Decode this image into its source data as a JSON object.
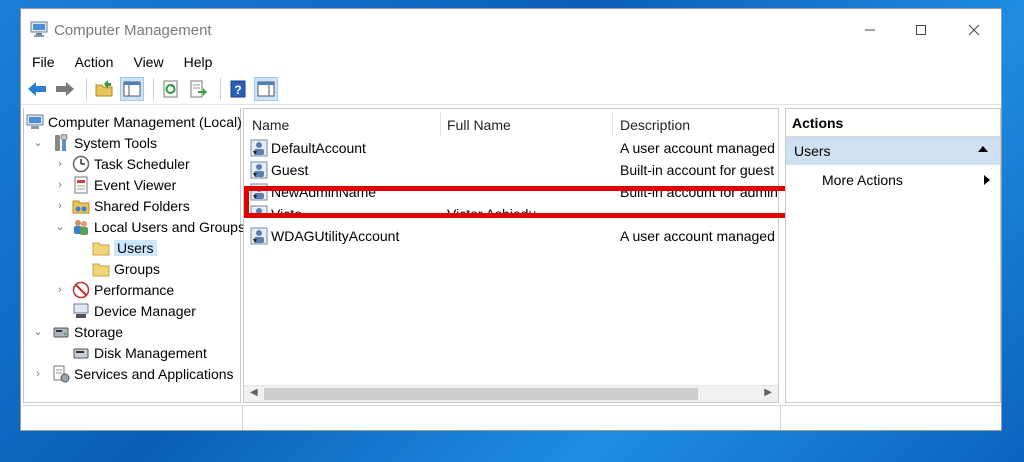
{
  "window": {
    "title": "Computer Management"
  },
  "menu": [
    "File",
    "Action",
    "View",
    "Help"
  ],
  "toolbar": {
    "buttons": [
      "back-icon",
      "forward-icon",
      "up-folder-icon",
      "show-hide-tree-icon",
      "refresh-icon",
      "export-list-icon",
      "help-icon",
      "show-hide-action-pane-icon"
    ]
  },
  "tree": {
    "root": "Computer Management (Local)",
    "system_tools": "System Tools",
    "task_scheduler": "Task Scheduler",
    "event_viewer": "Event Viewer",
    "shared_folders": "Shared Folders",
    "local_users_groups": "Local Users and Groups",
    "users": "Users",
    "groups": "Groups",
    "performance": "Performance",
    "device_manager": "Device Manager",
    "storage": "Storage",
    "disk_management": "Disk Management",
    "services_apps": "Services and Applications"
  },
  "list": {
    "columns": [
      "Name",
      "Full Name",
      "Description"
    ],
    "rows": [
      {
        "name": "DefaultAccount",
        "full_name": "",
        "description": "A user account managed b"
      },
      {
        "name": "Guest",
        "full_name": "",
        "description": "Built-in account for guest"
      },
      {
        "name": "NewAdminName",
        "full_name": "",
        "description": "Built-in account for admin"
      },
      {
        "name": "Victo",
        "full_name": "Victor Ashiedu",
        "description": ""
      },
      {
        "name": "WDAGUtilityAccount",
        "full_name": "",
        "description": "A user account managed a"
      }
    ]
  },
  "actions": {
    "header": "Actions",
    "section": "Users",
    "more_actions": "More Actions"
  },
  "colors": {
    "highlight": "#e00000",
    "selection": "#cce8ff",
    "actions_section": "#cfe0f2"
  }
}
